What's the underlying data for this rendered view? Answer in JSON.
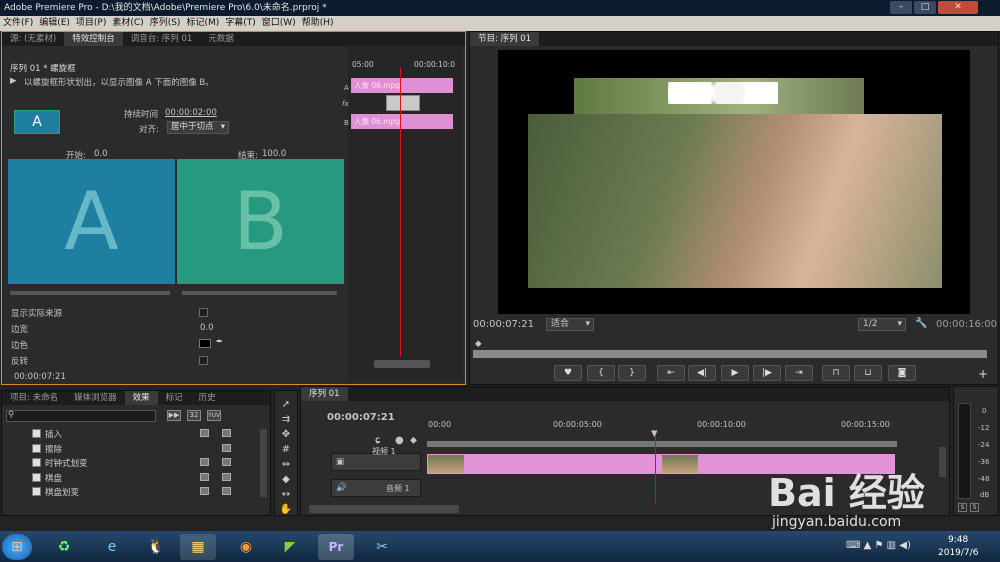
{
  "titlebar": {
    "title": "Adobe Premiere Pro - D:\\我的文档\\Adobe\\Premiere Pro\\6.0\\未命名.prproj *"
  },
  "menu": [
    "文件(F)",
    "编辑(E)",
    "项目(P)",
    "素材(C)",
    "序列(S)",
    "标记(M)",
    "字幕(T)",
    "窗口(W)",
    "帮助(H)"
  ],
  "effect_controls": {
    "tabs": [
      "源: (无素材)",
      "特效控制台",
      "调音台: 序列 01",
      "元数据"
    ],
    "sequence_label": "序列 01 * 螺旋框",
    "description": "以螺旋框形状划出，以显示图像 A 下面的图像 B。",
    "thumb_label": "A",
    "duration_label": "持续时间",
    "duration_value": "00:00:02:00",
    "align_label": "对齐:",
    "align_value": "居中于切点",
    "start_label": "开始:",
    "start_value": "0.0",
    "end_label": "结束:",
    "end_value": "100.0",
    "preview_a": "A",
    "preview_b": "B",
    "show_actual_sources": "显示实际来源",
    "border_width_label": "边宽",
    "border_width_value": "0.0",
    "border_color_label": "边色",
    "reverse_label": "反转",
    "timecode": "00:00:07:21",
    "mini_timeline": {
      "t_start": "05:00",
      "t_end": "00:00:10:0",
      "clip_a": "人像 06.mpg",
      "clip_b": "人像 06.mpg",
      "track_a": "A",
      "track_b": "B"
    }
  },
  "program_monitor": {
    "tab": "节目: 序列 01",
    "timecode": "00:00:07:21",
    "fit": "适合",
    "resolution": "1/2",
    "duration": "00:00:16:00"
  },
  "project_panel": {
    "tabs": [
      "项目: 未命名",
      "媒体浏览器",
      "效果",
      "标记",
      "历史"
    ],
    "effects": [
      "插入",
      "擦除",
      "时钟式划变",
      "棋盘",
      "棋盘划变"
    ]
  },
  "timeline": {
    "tab": "序列 01",
    "timecode": "00:00:07:21",
    "ruler": [
      "00:00",
      "00:00:05:00",
      "00:00:10:00",
      "00:00:15:00"
    ],
    "video_track": "视频 1",
    "audio_track": "音频 1"
  },
  "audio_meter": {
    "scale": [
      "0",
      "-12",
      "-24",
      "-36",
      "-48",
      "dB"
    ],
    "solo": [
      "S",
      "S"
    ]
  },
  "watermark": {
    "brand": "Bai 经验",
    "url": "jingyan.baidu.com"
  },
  "taskbar": {
    "time": "9:48",
    "date": "2019/7/6"
  }
}
